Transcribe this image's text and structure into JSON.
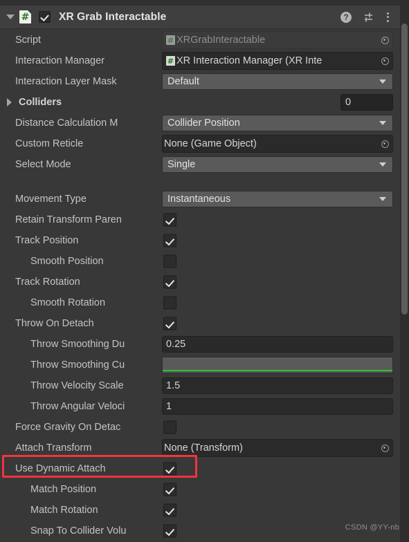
{
  "window": {
    "component_title": "XR Grab Interactable",
    "enabled": true,
    "script_icon": "csharp-script-icon",
    "help_icon": "?",
    "preset_icon": "preset-sliders-icon",
    "menu_icon": "three-dots-menu-icon"
  },
  "watermark": "CSDN @YY-nb",
  "fields": [
    {
      "name": "script",
      "label": "Script",
      "type": "object",
      "value": "XRGrabInteractable",
      "disabled": true,
      "indent": 0
    },
    {
      "name": "interaction-manager",
      "label": "Interaction Manager",
      "type": "object",
      "value": "XR Interaction Manager (XR Inte",
      "disabled": false,
      "indent": 0
    },
    {
      "name": "interaction-layer-mask",
      "label": "Interaction Layer Mask",
      "type": "dropdown",
      "value": "Default",
      "indent": 0
    },
    {
      "name": "colliders",
      "label": "Colliders",
      "type": "foldout-array",
      "value": "0",
      "expanded": false,
      "indent": 0
    },
    {
      "name": "distance-calculation-mode",
      "label": "Distance Calculation M",
      "type": "dropdown",
      "value": "Collider Position",
      "indent": 0
    },
    {
      "name": "custom-reticle",
      "label": "Custom Reticle",
      "type": "object-plain",
      "value": "None (Game Object)",
      "indent": 0
    },
    {
      "name": "select-mode",
      "label": "Select Mode",
      "type": "dropdown",
      "value": "Single",
      "indent": 0
    },
    {
      "name": "group-gap-1",
      "type": "spacer"
    },
    {
      "name": "movement-type",
      "label": "Movement Type",
      "type": "dropdown",
      "value": "Instantaneous",
      "indent": 0
    },
    {
      "name": "retain-transform-parent",
      "label": "Retain Transform Paren",
      "type": "checkbox",
      "checked": true,
      "indent": 0
    },
    {
      "name": "track-position",
      "label": "Track Position",
      "type": "checkbox",
      "checked": true,
      "indent": 0
    },
    {
      "name": "smooth-position",
      "label": "Smooth Position",
      "type": "checkbox",
      "checked": false,
      "indent": 1
    },
    {
      "name": "track-rotation",
      "label": "Track Rotation",
      "type": "checkbox",
      "checked": true,
      "indent": 0
    },
    {
      "name": "smooth-rotation",
      "label": "Smooth Rotation",
      "type": "checkbox",
      "checked": false,
      "indent": 1
    },
    {
      "name": "throw-on-detach",
      "label": "Throw On Detach",
      "type": "checkbox",
      "checked": true,
      "indent": 0
    },
    {
      "name": "throw-smoothing-duration",
      "label": "Throw Smoothing Du",
      "type": "number",
      "value": "0.25",
      "indent": 1
    },
    {
      "name": "throw-smoothing-curve",
      "label": "Throw Smoothing Cu",
      "type": "curve",
      "curve_color": "#2ec22e",
      "indent": 1
    },
    {
      "name": "throw-velocity-scale",
      "label": "Throw Velocity Scale",
      "type": "number",
      "value": "1.5",
      "indent": 1
    },
    {
      "name": "throw-angular-velocity-scale",
      "label": "Throw Angular Veloci",
      "type": "number",
      "value": "1",
      "indent": 1
    },
    {
      "name": "force-gravity-on-detach",
      "label": "Force Gravity On Detac",
      "type": "checkbox",
      "checked": false,
      "indent": 0
    },
    {
      "name": "attach-transform",
      "label": "Attach Transform",
      "type": "object-plain",
      "value": "None (Transform)",
      "indent": 0
    },
    {
      "name": "use-dynamic-attach",
      "label": "Use Dynamic Attach",
      "type": "checkbox",
      "checked": true,
      "indent": 0,
      "highlighted": true
    },
    {
      "name": "match-position",
      "label": "Match Position",
      "type": "checkbox",
      "checked": true,
      "indent": 1
    },
    {
      "name": "match-rotation",
      "label": "Match Rotation",
      "type": "checkbox",
      "checked": true,
      "indent": 1
    },
    {
      "name": "snap-to-collider-volume",
      "label": "Snap To Collider Volu",
      "type": "checkbox",
      "checked": true,
      "indent": 1
    }
  ]
}
